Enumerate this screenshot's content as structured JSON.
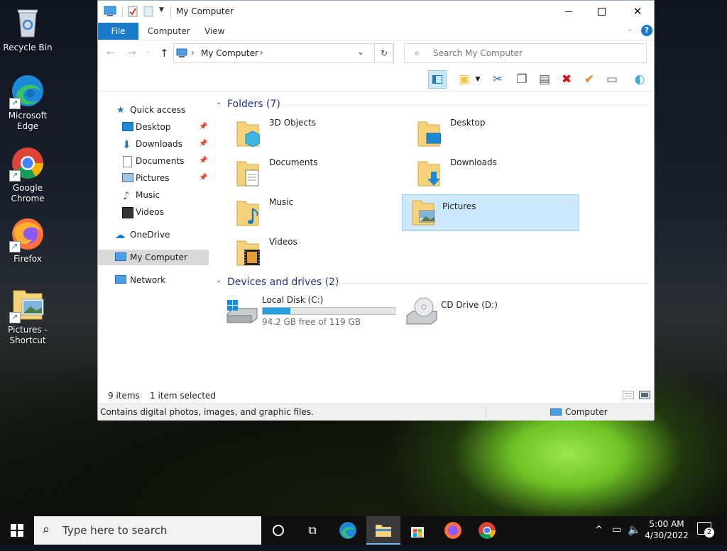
{
  "desktop": {
    "icons": [
      {
        "label": "Recycle Bin"
      },
      {
        "label": "Microsoft Edge"
      },
      {
        "label": "Google Chrome"
      },
      {
        "label": "Firefox"
      },
      {
        "label": "Pictures - Shortcut"
      }
    ]
  },
  "window": {
    "title": "My Computer",
    "ribbon": {
      "file": "File",
      "tabs": [
        "Computer",
        "View"
      ]
    },
    "address": {
      "segments": [
        "My Computer"
      ],
      "refresh": "↻"
    },
    "search": {
      "placeholder": "Search My Computer"
    },
    "nav": {
      "quick_access": "Quick access",
      "items": [
        "Desktop",
        "Downloads",
        "Documents",
        "Pictures",
        "Music",
        "Videos"
      ],
      "onedrive": "OneDrive",
      "my_computer": "My Computer",
      "network": "Network"
    },
    "folders_header": "Folders (7)",
    "folders": [
      "3D Objects",
      "Desktop",
      "Documents",
      "Downloads",
      "Music",
      "Pictures",
      "Videos"
    ],
    "selected_folder": "Pictures",
    "drives_header": "Devices and drives (2)",
    "drives": [
      {
        "name": "Local Disk (C:)",
        "free": "94.2 GB free of 119 GB",
        "used_fraction": 0.21
      },
      {
        "name": "CD Drive (D:)"
      }
    ],
    "status": {
      "count": "9 items",
      "selected": "1 item selected"
    },
    "statusbar": {
      "description": "Contains digital photos, images, and graphic files.",
      "location": "Computer"
    }
  },
  "taskbar": {
    "search_placeholder": "Type here to search",
    "time": "5:00 AM",
    "date": "4/30/2022",
    "notifications": "2"
  },
  "colors": {
    "accent": "#1979ca",
    "selection": "#cce8ff",
    "folder": "#f4d37a"
  }
}
